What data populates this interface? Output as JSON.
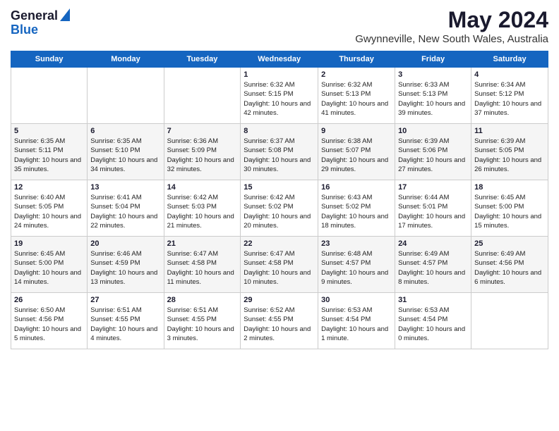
{
  "logo": {
    "line1": "General",
    "line2": "Blue"
  },
  "title": "May 2024",
  "subtitle": "Gwynneville, New South Wales, Australia",
  "days_of_week": [
    "Sunday",
    "Monday",
    "Tuesday",
    "Wednesday",
    "Thursday",
    "Friday",
    "Saturday"
  ],
  "weeks": [
    [
      {
        "day": "",
        "sunrise": "",
        "sunset": "",
        "daylight": ""
      },
      {
        "day": "",
        "sunrise": "",
        "sunset": "",
        "daylight": ""
      },
      {
        "day": "",
        "sunrise": "",
        "sunset": "",
        "daylight": ""
      },
      {
        "day": "1",
        "sunrise": "Sunrise: 6:32 AM",
        "sunset": "Sunset: 5:15 PM",
        "daylight": "Daylight: 10 hours and 42 minutes."
      },
      {
        "day": "2",
        "sunrise": "Sunrise: 6:32 AM",
        "sunset": "Sunset: 5:13 PM",
        "daylight": "Daylight: 10 hours and 41 minutes."
      },
      {
        "day": "3",
        "sunrise": "Sunrise: 6:33 AM",
        "sunset": "Sunset: 5:13 PM",
        "daylight": "Daylight: 10 hours and 39 minutes."
      },
      {
        "day": "4",
        "sunrise": "Sunrise: 6:34 AM",
        "sunset": "Sunset: 5:12 PM",
        "daylight": "Daylight: 10 hours and 37 minutes."
      }
    ],
    [
      {
        "day": "5",
        "sunrise": "Sunrise: 6:35 AM",
        "sunset": "Sunset: 5:11 PM",
        "daylight": "Daylight: 10 hours and 35 minutes."
      },
      {
        "day": "6",
        "sunrise": "Sunrise: 6:35 AM",
        "sunset": "Sunset: 5:10 PM",
        "daylight": "Daylight: 10 hours and 34 minutes."
      },
      {
        "day": "7",
        "sunrise": "Sunrise: 6:36 AM",
        "sunset": "Sunset: 5:09 PM",
        "daylight": "Daylight: 10 hours and 32 minutes."
      },
      {
        "day": "8",
        "sunrise": "Sunrise: 6:37 AM",
        "sunset": "Sunset: 5:08 PM",
        "daylight": "Daylight: 10 hours and 30 minutes."
      },
      {
        "day": "9",
        "sunrise": "Sunrise: 6:38 AM",
        "sunset": "Sunset: 5:07 PM",
        "daylight": "Daylight: 10 hours and 29 minutes."
      },
      {
        "day": "10",
        "sunrise": "Sunrise: 6:39 AM",
        "sunset": "Sunset: 5:06 PM",
        "daylight": "Daylight: 10 hours and 27 minutes."
      },
      {
        "day": "11",
        "sunrise": "Sunrise: 6:39 AM",
        "sunset": "Sunset: 5:05 PM",
        "daylight": "Daylight: 10 hours and 26 minutes."
      }
    ],
    [
      {
        "day": "12",
        "sunrise": "Sunrise: 6:40 AM",
        "sunset": "Sunset: 5:05 PM",
        "daylight": "Daylight: 10 hours and 24 minutes."
      },
      {
        "day": "13",
        "sunrise": "Sunrise: 6:41 AM",
        "sunset": "Sunset: 5:04 PM",
        "daylight": "Daylight: 10 hours and 22 minutes."
      },
      {
        "day": "14",
        "sunrise": "Sunrise: 6:42 AM",
        "sunset": "Sunset: 5:03 PM",
        "daylight": "Daylight: 10 hours and 21 minutes."
      },
      {
        "day": "15",
        "sunrise": "Sunrise: 6:42 AM",
        "sunset": "Sunset: 5:02 PM",
        "daylight": "Daylight: 10 hours and 20 minutes."
      },
      {
        "day": "16",
        "sunrise": "Sunrise: 6:43 AM",
        "sunset": "Sunset: 5:02 PM",
        "daylight": "Daylight: 10 hours and 18 minutes."
      },
      {
        "day": "17",
        "sunrise": "Sunrise: 6:44 AM",
        "sunset": "Sunset: 5:01 PM",
        "daylight": "Daylight: 10 hours and 17 minutes."
      },
      {
        "day": "18",
        "sunrise": "Sunrise: 6:45 AM",
        "sunset": "Sunset: 5:00 PM",
        "daylight": "Daylight: 10 hours and 15 minutes."
      }
    ],
    [
      {
        "day": "19",
        "sunrise": "Sunrise: 6:45 AM",
        "sunset": "Sunset: 5:00 PM",
        "daylight": "Daylight: 10 hours and 14 minutes."
      },
      {
        "day": "20",
        "sunrise": "Sunrise: 6:46 AM",
        "sunset": "Sunset: 4:59 PM",
        "daylight": "Daylight: 10 hours and 13 minutes."
      },
      {
        "day": "21",
        "sunrise": "Sunrise: 6:47 AM",
        "sunset": "Sunset: 4:58 PM",
        "daylight": "Daylight: 10 hours and 11 minutes."
      },
      {
        "day": "22",
        "sunrise": "Sunrise: 6:47 AM",
        "sunset": "Sunset: 4:58 PM",
        "daylight": "Daylight: 10 hours and 10 minutes."
      },
      {
        "day": "23",
        "sunrise": "Sunrise: 6:48 AM",
        "sunset": "Sunset: 4:57 PM",
        "daylight": "Daylight: 10 hours and 9 minutes."
      },
      {
        "day": "24",
        "sunrise": "Sunrise: 6:49 AM",
        "sunset": "Sunset: 4:57 PM",
        "daylight": "Daylight: 10 hours and 8 minutes."
      },
      {
        "day": "25",
        "sunrise": "Sunrise: 6:49 AM",
        "sunset": "Sunset: 4:56 PM",
        "daylight": "Daylight: 10 hours and 6 minutes."
      }
    ],
    [
      {
        "day": "26",
        "sunrise": "Sunrise: 6:50 AM",
        "sunset": "Sunset: 4:56 PM",
        "daylight": "Daylight: 10 hours and 5 minutes."
      },
      {
        "day": "27",
        "sunrise": "Sunrise: 6:51 AM",
        "sunset": "Sunset: 4:55 PM",
        "daylight": "Daylight: 10 hours and 4 minutes."
      },
      {
        "day": "28",
        "sunrise": "Sunrise: 6:51 AM",
        "sunset": "Sunset: 4:55 PM",
        "daylight": "Daylight: 10 hours and 3 minutes."
      },
      {
        "day": "29",
        "sunrise": "Sunrise: 6:52 AM",
        "sunset": "Sunset: 4:55 PM",
        "daylight": "Daylight: 10 hours and 2 minutes."
      },
      {
        "day": "30",
        "sunrise": "Sunrise: 6:53 AM",
        "sunset": "Sunset: 4:54 PM",
        "daylight": "Daylight: 10 hours and 1 minute."
      },
      {
        "day": "31",
        "sunrise": "Sunrise: 6:53 AM",
        "sunset": "Sunset: 4:54 PM",
        "daylight": "Daylight: 10 hours and 0 minutes."
      },
      {
        "day": "",
        "sunrise": "",
        "sunset": "",
        "daylight": ""
      }
    ]
  ]
}
